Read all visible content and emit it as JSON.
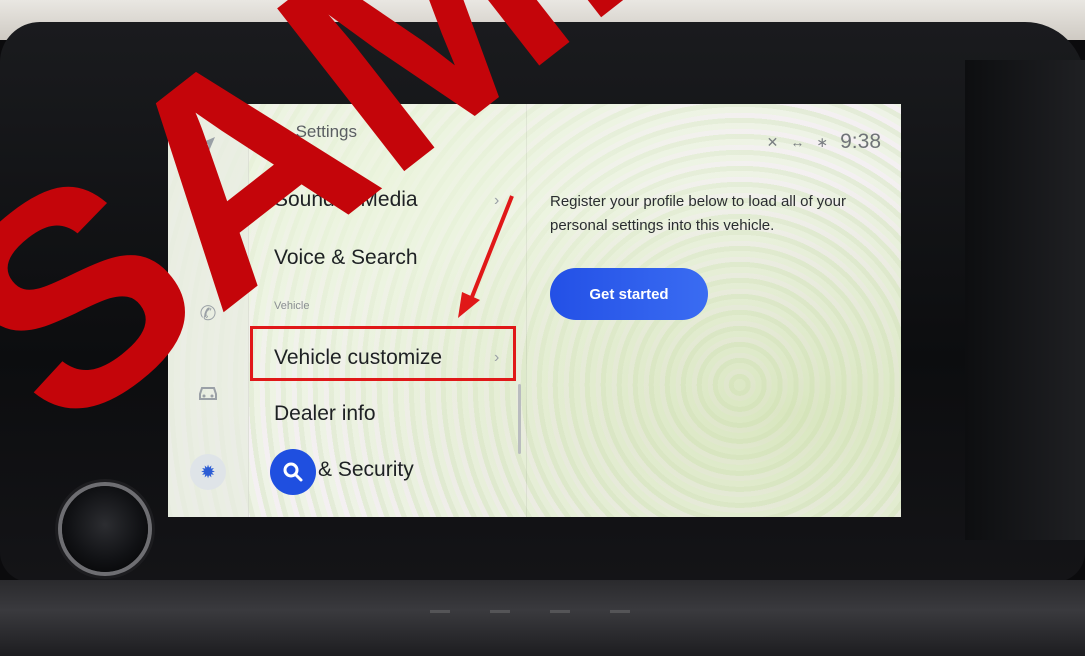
{
  "watermark": {
    "text": "SAMPLE"
  },
  "rail": {
    "icons": [
      "navigation-icon",
      "music-icon",
      "phone-icon",
      "car-icon",
      "settings-icon"
    ]
  },
  "settings": {
    "header": "Settings",
    "items": [
      {
        "label": "Sound & Media"
      },
      {
        "label": "Voice & Search"
      },
      {
        "label": "Vehicle customize"
      },
      {
        "label": "Dealer info"
      },
      {
        "label": "& Security"
      }
    ],
    "section_label": "Vehicle"
  },
  "status_bar": {
    "time": "9:38"
  },
  "profile": {
    "description": "Register your profile below to load all of your personal settings into this vehicle.",
    "button_label": "Get started"
  },
  "colors": {
    "accent": "#1f4fe0",
    "annotation": "#e01818"
  }
}
